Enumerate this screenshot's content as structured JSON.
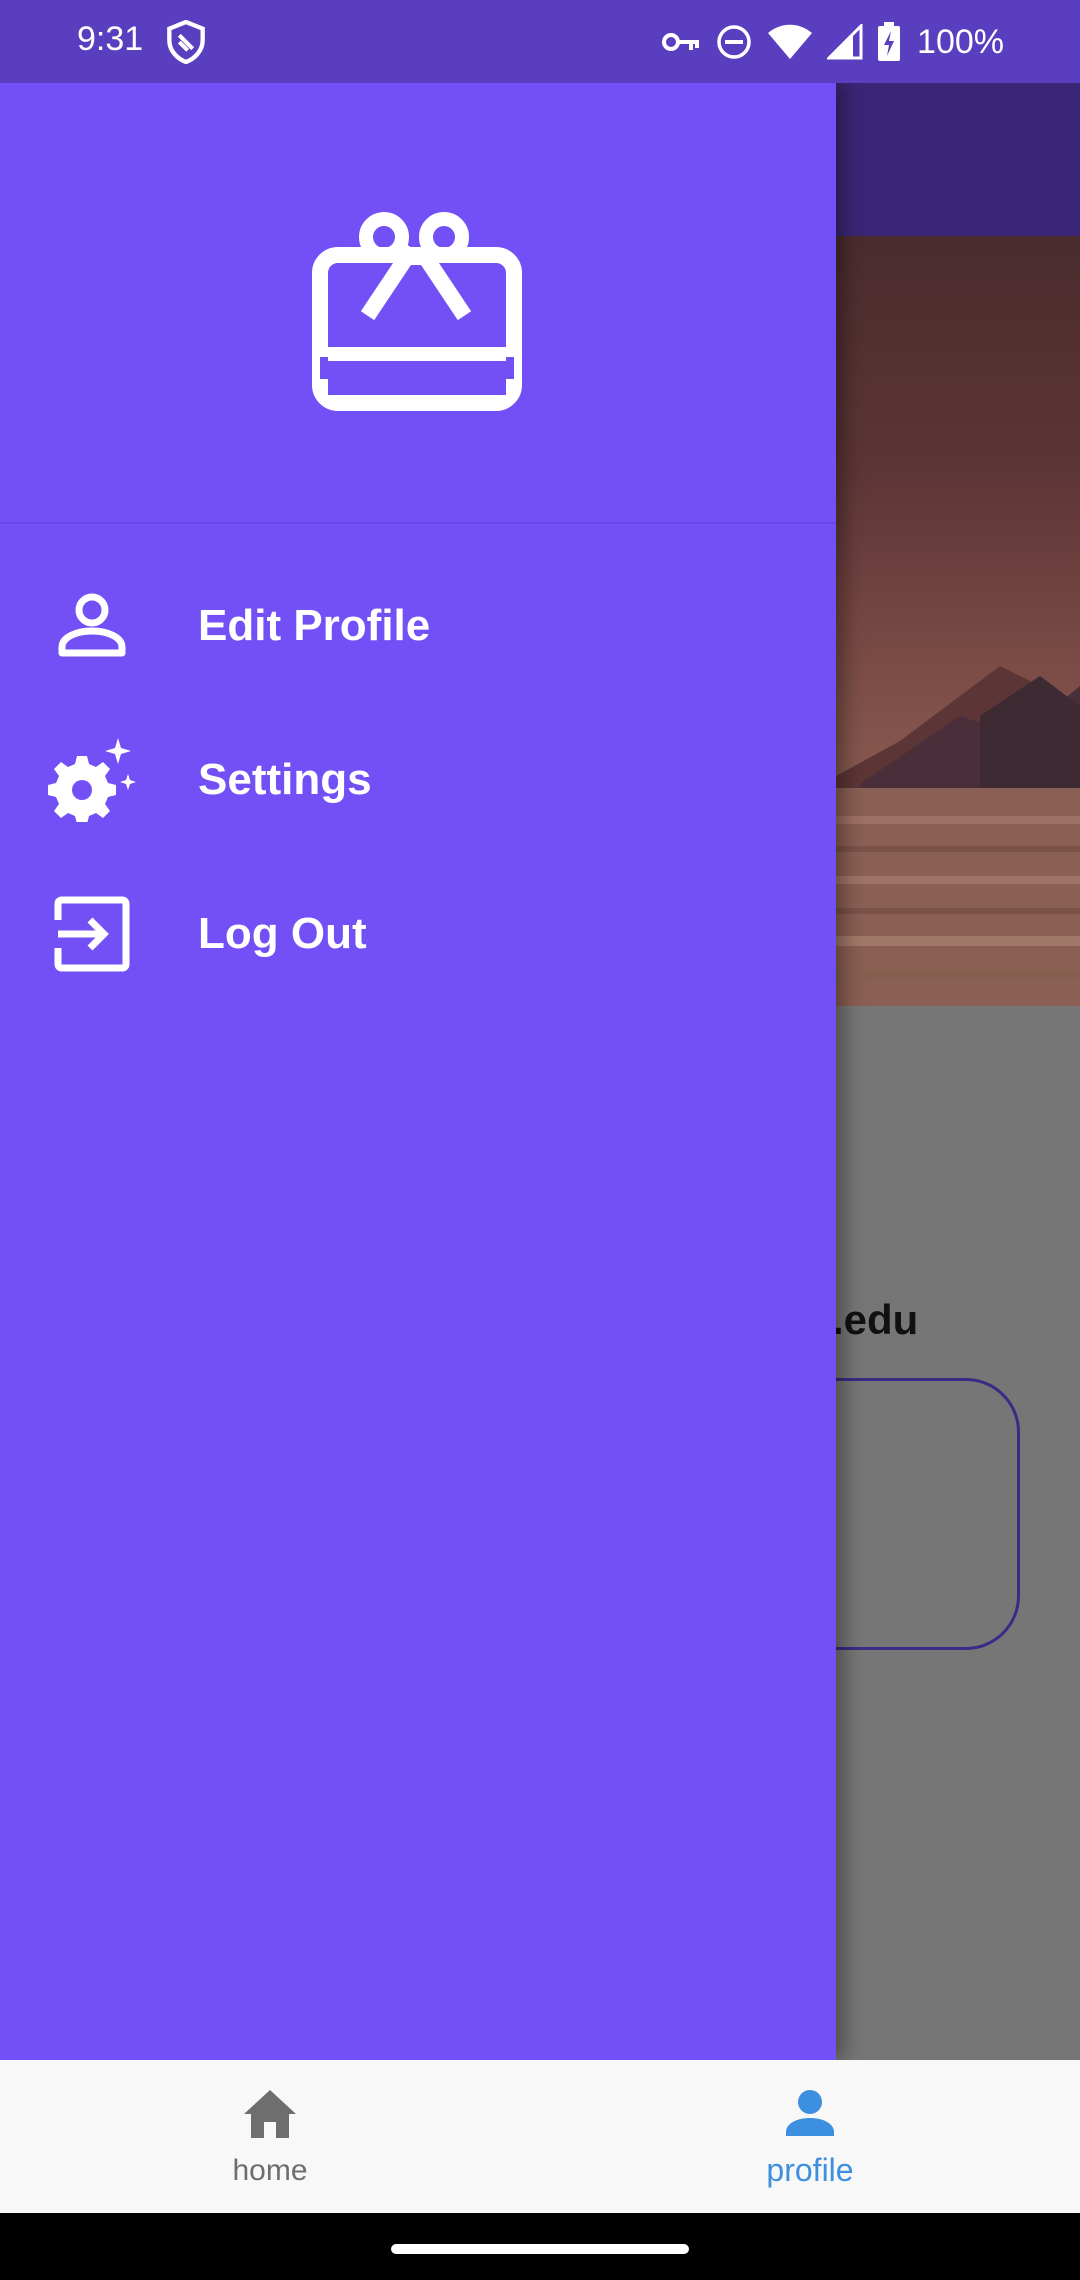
{
  "status_bar": {
    "time": "9:31",
    "battery_percent": "100%",
    "icons": [
      "shield-icon",
      "vpn-key-icon",
      "do-not-disturb-icon",
      "wifi-icon",
      "cell-signal-icon",
      "battery-charging-icon"
    ]
  },
  "background_screen": {
    "email_fragment": ".edu"
  },
  "drawer": {
    "logo_icon": "gift-card-icon",
    "items": [
      {
        "label": "Edit Profile",
        "icon": "person-icon"
      },
      {
        "label": "Settings",
        "icon": "settings-sparkle-icon"
      },
      {
        "label": "Log Out",
        "icon": "logout-icon"
      }
    ]
  },
  "bottom_nav": {
    "items": [
      {
        "label": "home",
        "icon": "home-icon",
        "selected": false
      },
      {
        "label": "profile",
        "icon": "person-icon",
        "selected": true
      }
    ]
  },
  "colors": {
    "drawer_bg": "#7350f5",
    "status_bar_bg": "#5a3ec0",
    "selected_nav": "#3d8fe0",
    "unselected_nav": "#6e6e6e"
  }
}
